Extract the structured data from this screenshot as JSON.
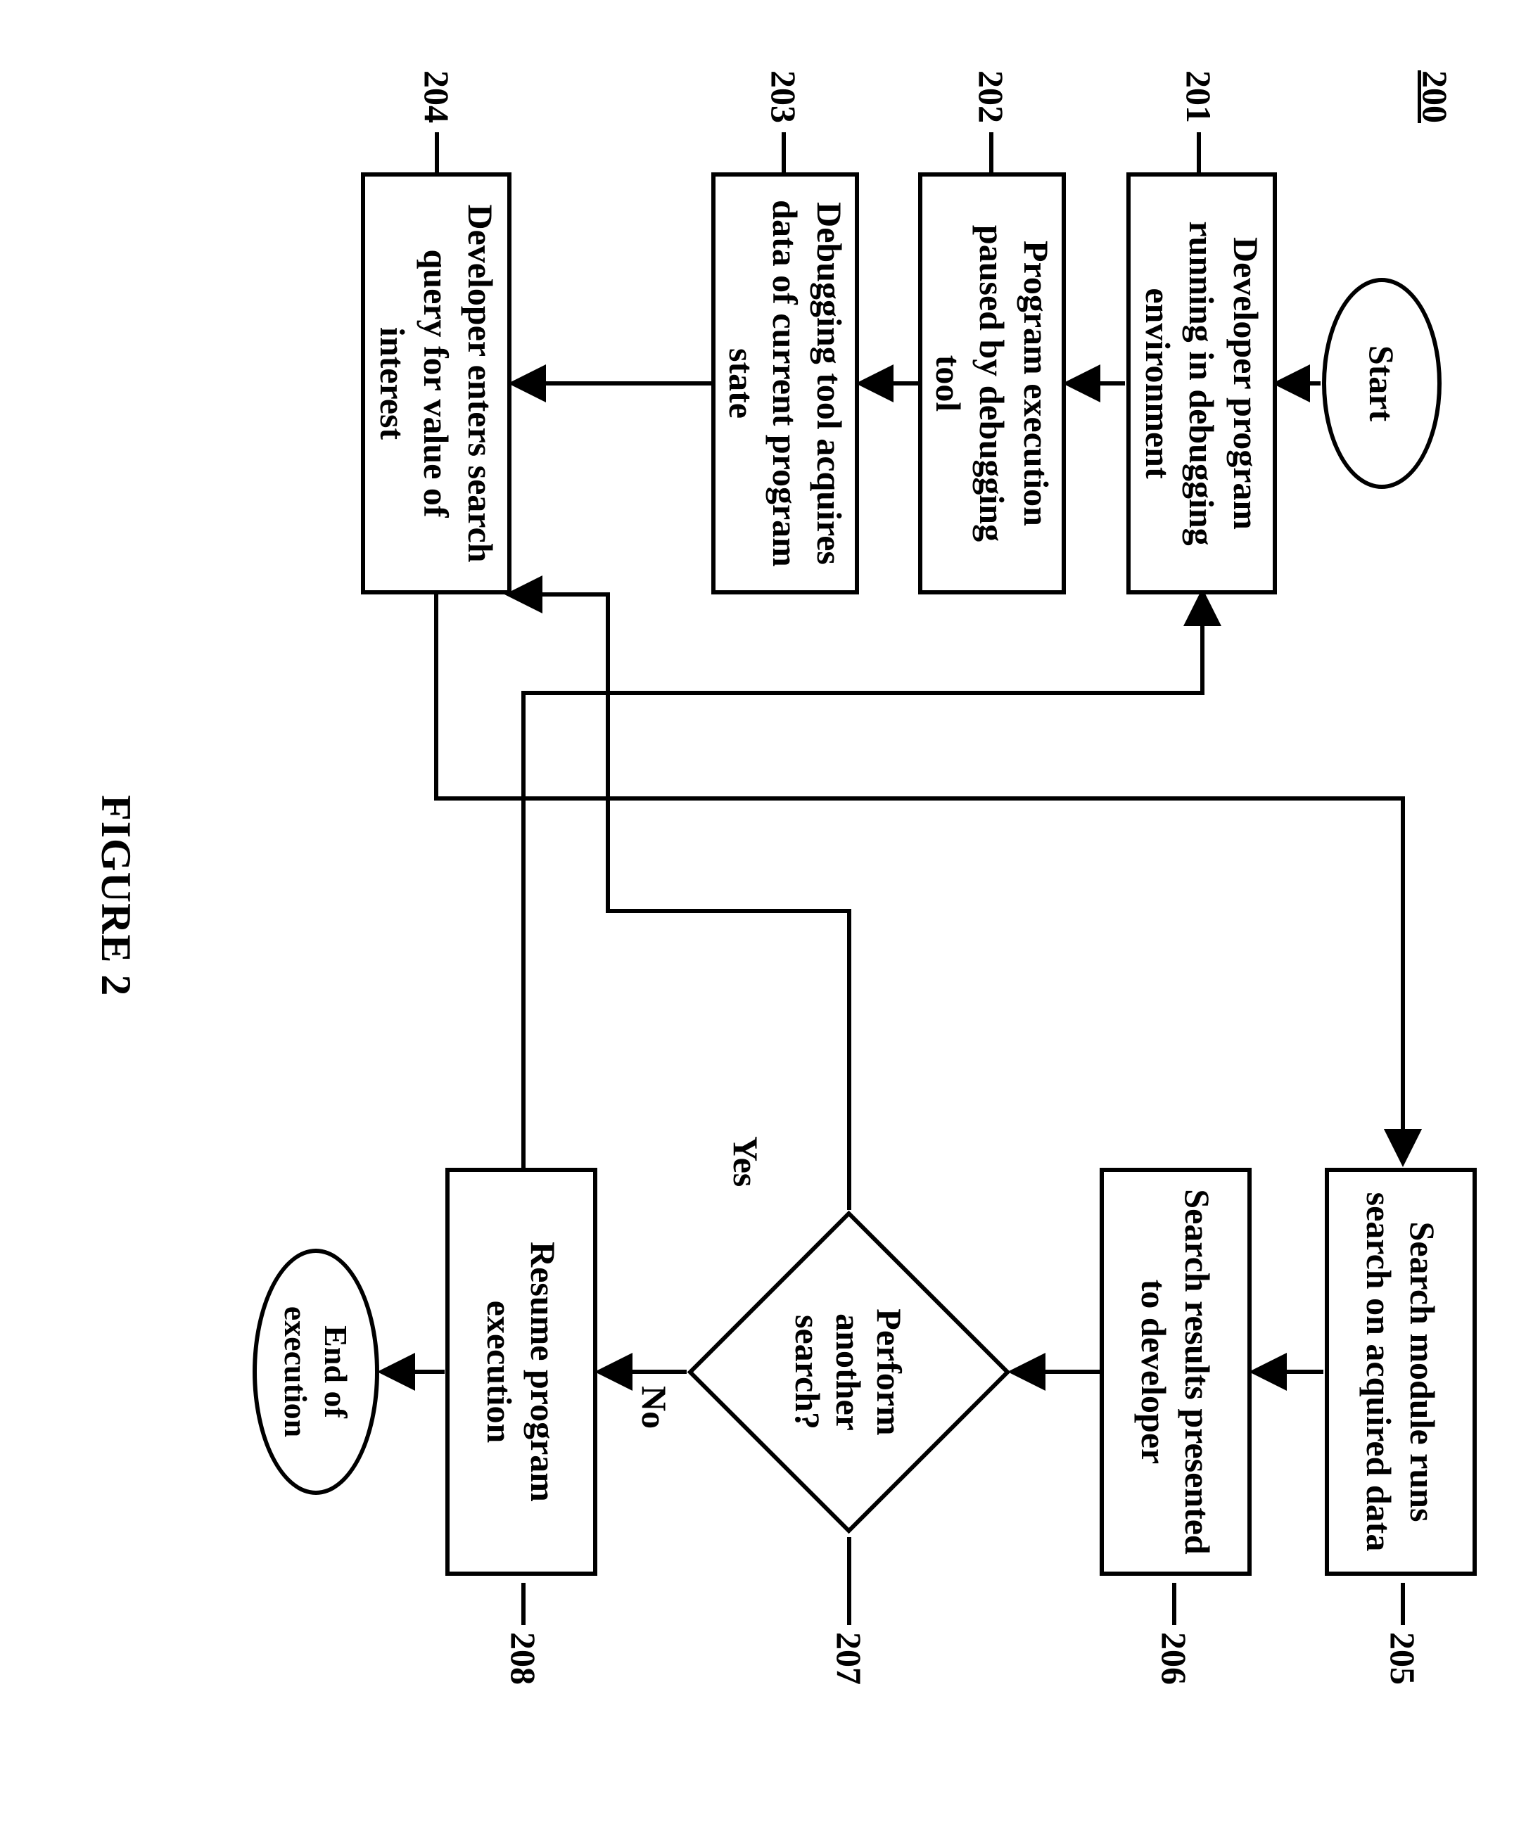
{
  "page_id": "200",
  "figure_label": "FIGURE 2",
  "start_label": "Start",
  "end_label": "End of execution",
  "yes_label": "Yes",
  "no_label": "No",
  "boxes": {
    "b201": {
      "num": "201",
      "text": "Developer program running in debugging environment"
    },
    "b202": {
      "num": "202",
      "text": "Program execution paused by debugging tool"
    },
    "b203": {
      "num": "203",
      "text": "Debugging tool acquires data of current program state"
    },
    "b204": {
      "num": "204",
      "text": "Developer enters search query for value of interest"
    },
    "b205": {
      "num": "205",
      "text": "Search module runs search on acquired data"
    },
    "b206": {
      "num": "206",
      "text": "Search results presented to developer"
    },
    "b207": {
      "num": "207",
      "text": "Perform another search?"
    },
    "b208": {
      "num": "208",
      "text": "Resume program execution"
    }
  }
}
